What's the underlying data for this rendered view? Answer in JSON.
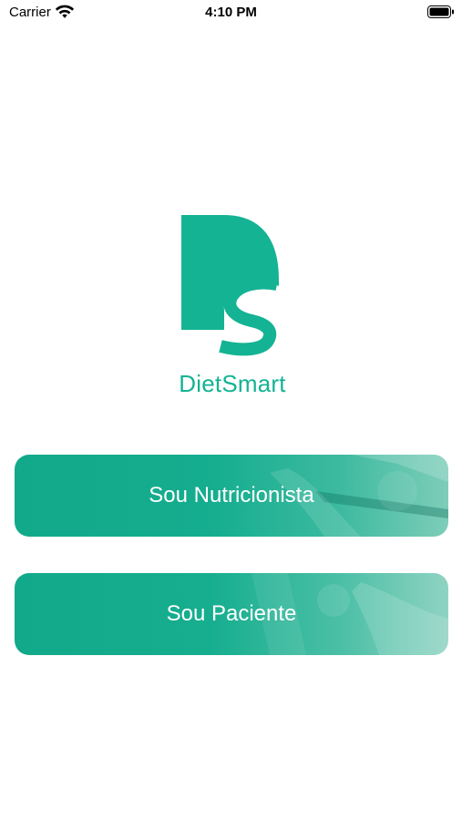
{
  "status_bar": {
    "carrier": "Carrier",
    "time": "4:10 PM",
    "icons": [
      "wifi-icon",
      "battery-icon"
    ]
  },
  "brand": {
    "name": "DietSmart",
    "color": "#14b393"
  },
  "buttons": [
    {
      "label": "Sou Nutricionista"
    },
    {
      "label": "Sou Paciente"
    }
  ],
  "colors": {
    "accent": "#14b393",
    "button_dark": "#12a98a"
  }
}
